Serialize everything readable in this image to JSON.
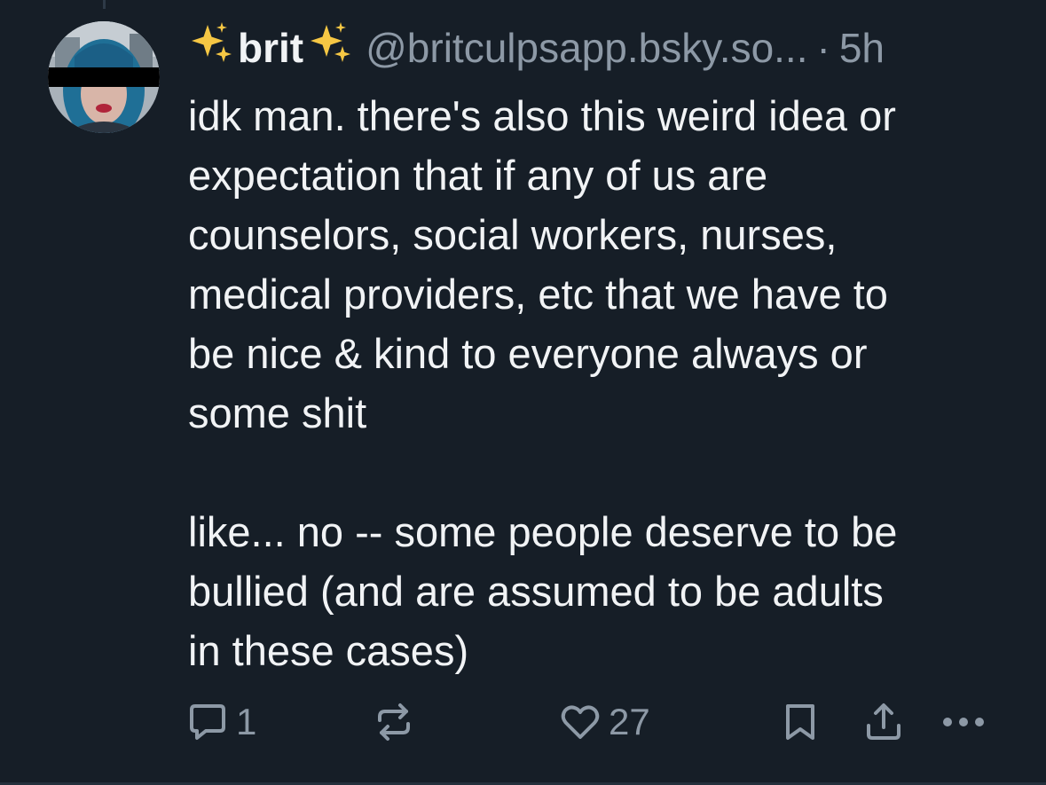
{
  "post": {
    "author": {
      "display_name": "brit",
      "handle": "@britculpsapp.bsky.so...",
      "age": "5h",
      "separator": "·"
    },
    "text": "idk man. there's also this weird idea or\nexpectation that if any of us are\ncounselors, social workers, nurses,\nmedical providers, etc that we have to\nbe nice & kind to everyone always or\nsome shit\n\nlike... no -- some people deserve to be\nbullied (and are assumed to be adults\nin these cases)",
    "actions": {
      "reply_count": "1",
      "repost_count": "",
      "like_count": "27"
    }
  },
  "icons": {
    "sparkles": "sparkles-icon",
    "reply": "reply-bubble-icon",
    "repost": "repost-icon",
    "like": "heart-icon",
    "bookmark": "bookmark-icon",
    "share": "share-icon",
    "more": "more-icon"
  },
  "colors": {
    "background": "#161e27",
    "text": "#f1f3f5",
    "muted": "#8d99a6",
    "sparkle": "#f6c744"
  }
}
